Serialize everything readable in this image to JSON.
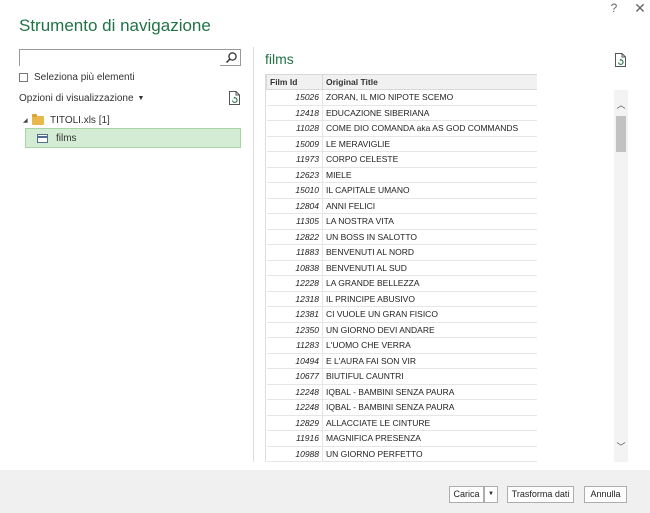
{
  "window": {
    "title": "Strumento di navigazione",
    "help_glyph": "?",
    "close_glyph": "✕"
  },
  "navigator": {
    "search_placeholder": "",
    "search_icon": "search-icon",
    "select_multiple_label": "Seleziona più elementi",
    "view_options_label": "Opzioni di visualizzazione",
    "tree": {
      "root_label": "TITOLI.xls [1]",
      "child_label": "films"
    }
  },
  "preview": {
    "title": "films",
    "columns": [
      "Film Id",
      "Original Title"
    ],
    "rows": [
      [
        "15026",
        "ZORAN, IL MIO NIPOTE SCEMO"
      ],
      [
        "12418",
        "EDUCAZIONE SIBERIANA"
      ],
      [
        "11028",
        "COME DIO COMANDA aka AS GOD COMMANDS"
      ],
      [
        "15009",
        "LE MERAVIGLIE"
      ],
      [
        "11973",
        "CORPO CELESTE"
      ],
      [
        "12623",
        "MIELE"
      ],
      [
        "15010",
        "IL CAPITALE UMANO"
      ],
      [
        "12804",
        "ANNI FELICI"
      ],
      [
        "11305",
        "LA NOSTRA VITA"
      ],
      [
        "12822",
        "UN BOSS IN SALOTTO"
      ],
      [
        "11883",
        "BENVENUTI AL NORD"
      ],
      [
        "10838",
        "BENVENUTI AL SUD"
      ],
      [
        "12228",
        "LA GRANDE BELLEZZA"
      ],
      [
        "12318",
        "IL PRINCIPE ABUSIVO"
      ],
      [
        "12381",
        "CI VUOLE UN GRAN FISICO"
      ],
      [
        "12350",
        "UN GIORNO DEVI ANDARE"
      ],
      [
        "11283",
        "L'UOMO CHE VERRA"
      ],
      [
        "10494",
        "E L'AURA FAI SON VIR"
      ],
      [
        "10677",
        "BIUTIFUL CAUNTRI"
      ],
      [
        "12248",
        "IQBAL - BAMBINI SENZA PAURA"
      ],
      [
        "12248",
        "IQBAL - BAMBINI SENZA PAURA"
      ],
      [
        "12829",
        "ALLACCIATE LE CINTURE"
      ],
      [
        "11916",
        "MAGNIFICA PRESENZA"
      ],
      [
        "10988",
        "UN GIORNO PERFETTO"
      ]
    ]
  },
  "footer": {
    "load_label": "Carica",
    "transform_label": "Trasforma dati",
    "cancel_label": "Annulla"
  },
  "colors": {
    "accent": "#217346",
    "selection": "#d5ecd4"
  }
}
